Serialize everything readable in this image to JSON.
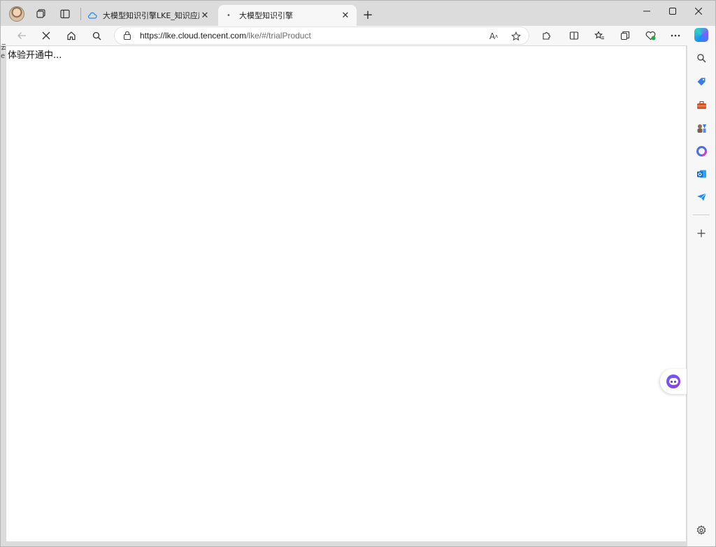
{
  "tabs": [
    {
      "title": "大模型知识引擎LKE_知识应用搭建",
      "active": false,
      "icon": "cloud-icon"
    },
    {
      "title": "大模型知识引擎",
      "active": true,
      "icon": "loading-dot-icon"
    }
  ],
  "toolbar": {
    "url_host": "https://lke.cloud.tencent.com",
    "url_path": "/lke/#/trialProduct"
  },
  "page": {
    "status_text": "体验开通中...",
    "edge_stub": "云\ne"
  },
  "sidebar": {
    "items": [
      "copilot-icon",
      "search-icon",
      "tag-icon",
      "toolbox-icon",
      "games-icon",
      "office-icon",
      "outlook-icon",
      "send-icon",
      "add-icon",
      "settings-icon"
    ]
  },
  "colors": {
    "accent": "#1d8cf8",
    "bot": "#6a5cff"
  }
}
